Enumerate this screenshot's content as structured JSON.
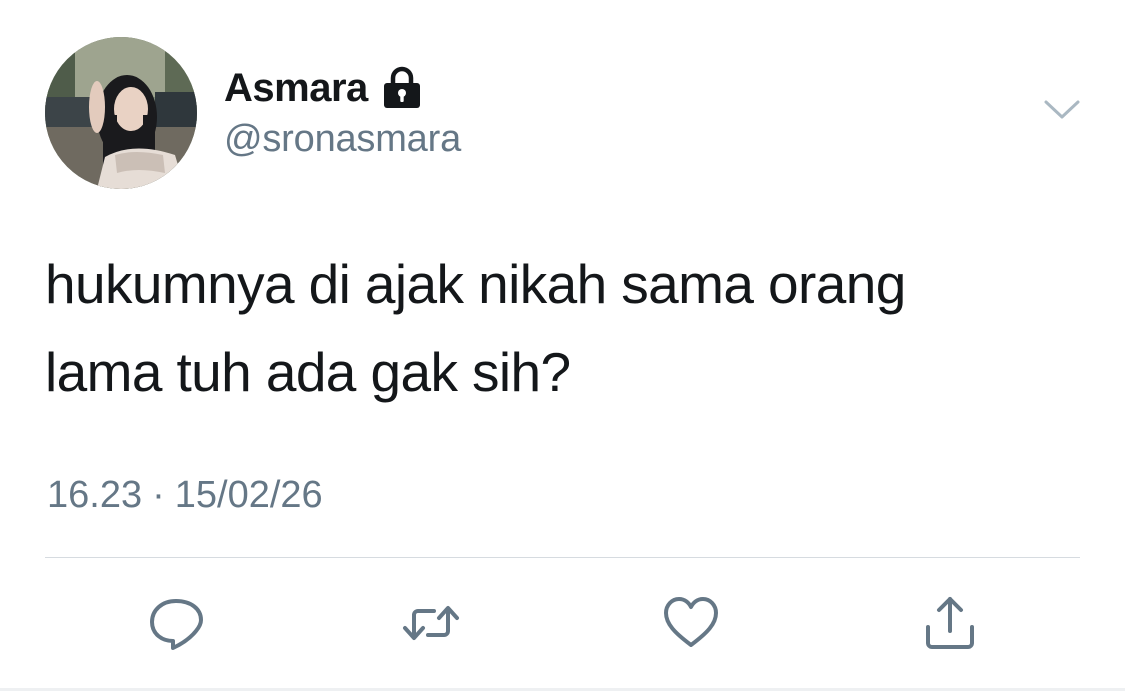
{
  "user": {
    "display_name": "Asmara",
    "handle": "@sronasmara",
    "protected": true,
    "avatar_icon": "avatar-photo",
    "lock_icon": "lock-icon"
  },
  "tweet": {
    "text_line1": "hukumnya di ajak nikah sama orang",
    "text_line2": "lama tuh ada gak sih?",
    "time": "16.23",
    "separator": "·",
    "date": "15/02/26"
  },
  "actions": [
    {
      "name": "reply",
      "icon": "reply-icon"
    },
    {
      "name": "retweet",
      "icon": "retweet-icon"
    },
    {
      "name": "like",
      "icon": "heart-icon"
    },
    {
      "name": "share",
      "icon": "share-icon"
    }
  ],
  "colors": {
    "text_primary": "#14171a",
    "text_secondary": "#657786",
    "icon": "#657786",
    "divider": "#d6dbe0",
    "background": "#ffffff"
  }
}
